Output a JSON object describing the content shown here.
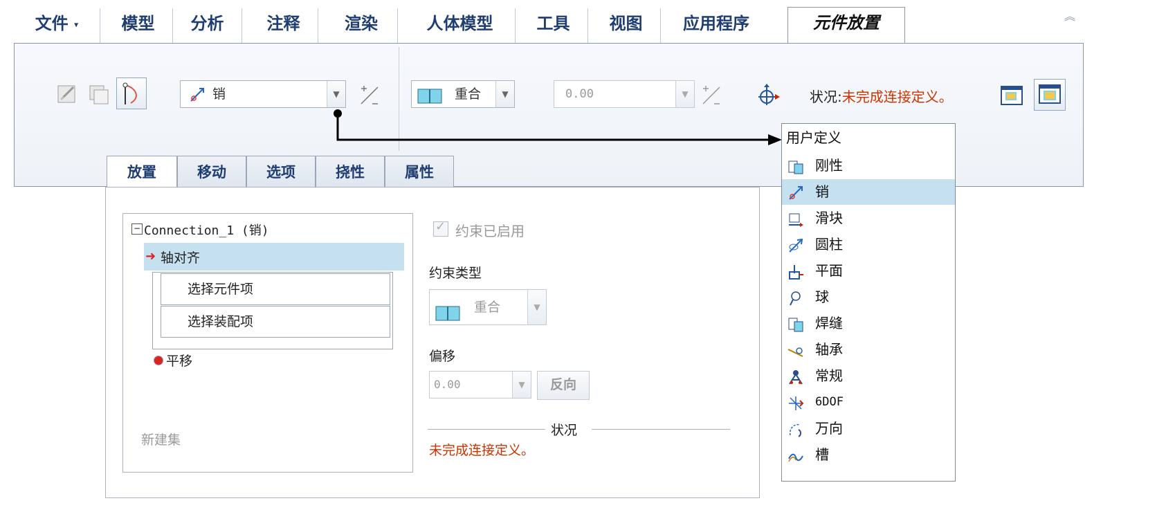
{
  "ribbon_tabs": [
    {
      "label": "文件",
      "has_caret": true
    },
    {
      "label": "模型"
    },
    {
      "label": "分析"
    },
    {
      "label": "注释"
    },
    {
      "label": "渲染"
    },
    {
      "label": "人体模型"
    },
    {
      "label": "工具"
    },
    {
      "label": "视图"
    },
    {
      "label": "应用程序"
    },
    {
      "label": "元件放置",
      "active": true
    }
  ],
  "ribbon": {
    "connection_type": "销",
    "constraint_type": "重合",
    "offset_value": "0.00",
    "status_label": "状况:",
    "status_text": "未完成连接定义。"
  },
  "subtabs": [
    "放置",
    "移动",
    "选项",
    "挠性",
    "属性"
  ],
  "placement_panel": {
    "tree_root": "Connection_1 (销)",
    "axis_align": "轴对齐",
    "select_component": "选择元件项",
    "select_assembly": "选择装配项",
    "translation": "平移",
    "new_set": "新建集",
    "constraint_enabled": "约束已启用",
    "constraint_type_label": "约束类型",
    "constraint_type_value": "重合",
    "offset_label": "偏移",
    "offset_value": "0.00",
    "flip_button": "反向",
    "status_header": "状况",
    "status_text": "未完成连接定义。"
  },
  "connection_menu": {
    "items": [
      {
        "label": "用户定义",
        "icon": ""
      },
      {
        "label": "刚性",
        "icon": "rigid-icon"
      },
      {
        "label": "销",
        "icon": "pin-icon",
        "selected": true
      },
      {
        "label": "滑块",
        "icon": "slider-icon"
      },
      {
        "label": "圆柱",
        "icon": "cylinder-icon"
      },
      {
        "label": "平面",
        "icon": "planar-icon"
      },
      {
        "label": "球",
        "icon": "ball-icon"
      },
      {
        "label": "焊缝",
        "icon": "weld-icon"
      },
      {
        "label": "轴承",
        "icon": "bearing-icon"
      },
      {
        "label": "常规",
        "icon": "general-icon"
      },
      {
        "label": "6DOF",
        "icon": "6dof-icon"
      },
      {
        "label": "万向",
        "icon": "gimbal-icon"
      },
      {
        "label": "槽",
        "icon": "slot-icon"
      }
    ]
  },
  "colors": {
    "accent": "#1f3d73",
    "status_red": "#cc3300",
    "selection": "#c5e0ee",
    "cyan_icon": "#7fd3ea"
  }
}
